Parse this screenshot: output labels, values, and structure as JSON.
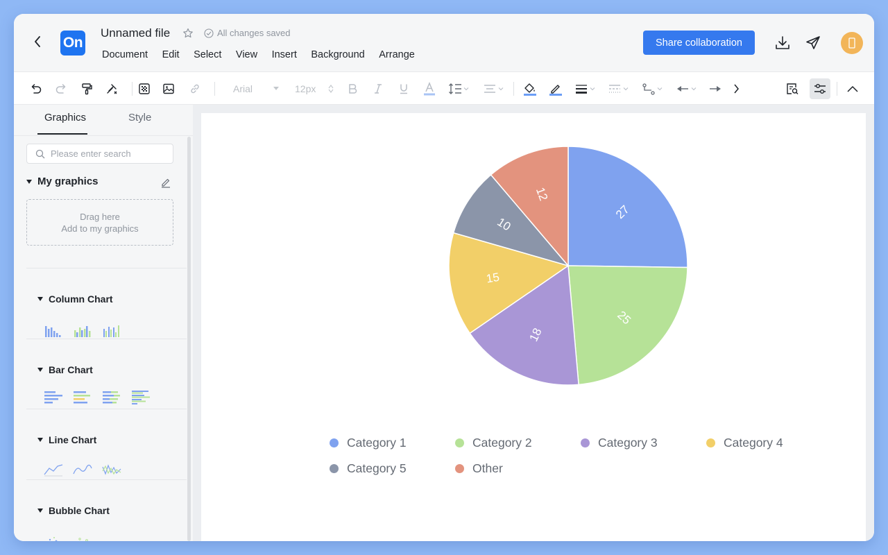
{
  "header": {
    "logo": "On",
    "file_title": "Unnamed file",
    "saved_status": "All changes saved",
    "menu": [
      "Document",
      "Edit",
      "Select",
      "View",
      "Insert",
      "Background",
      "Arrange"
    ],
    "share_label": "Share collaboration"
  },
  "toolbar": {
    "font_name": "Arial",
    "font_size": "12px",
    "icons": [
      "undo-icon",
      "redo-icon",
      "format-painter-icon",
      "clear-format-icon",
      "table-icon",
      "image-icon",
      "link-icon",
      "bold-icon",
      "italic-icon",
      "underline-icon",
      "font-color-icon",
      "line-spacing-icon",
      "align-icon",
      "fill-color-icon",
      "line-color-icon",
      "line-width-icon",
      "line-style-icon",
      "connector-icon",
      "arrow-start-icon",
      "arrow-end-icon",
      "more-icon",
      "find-icon",
      "settings-icon",
      "collapse-icon"
    ],
    "accent_color": "#6b9df5"
  },
  "sidebar": {
    "tabs": [
      "Graphics",
      "Style"
    ],
    "search_placeholder": "Please enter search",
    "my_graphics_title": "My graphics",
    "dropzone_line1": "Drag here",
    "dropzone_line2": "Add to my graphics",
    "sections": [
      "Column Chart",
      "Bar Chart",
      "Line Chart",
      "Bubble Chart"
    ]
  },
  "chart_data": {
    "type": "pie",
    "categories": [
      "Category 1",
      "Category 2",
      "Category 3",
      "Category 4",
      "Category 5",
      "Other"
    ],
    "values": [
      27,
      25,
      18,
      15,
      10,
      12
    ],
    "colors": [
      "#7fa2ef",
      "#b6e297",
      "#a996d6",
      "#f2cf68",
      "#8b95a9",
      "#e3937e"
    ],
    "legend_position": "bottom"
  }
}
